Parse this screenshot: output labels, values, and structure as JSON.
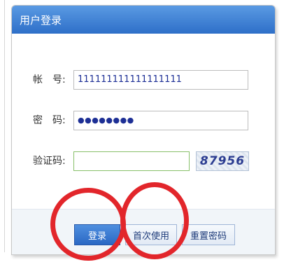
{
  "dialog": {
    "title": "用户登录"
  },
  "form": {
    "account_label": "帐　号:",
    "account_value": "111111111111111111",
    "password_label": "密　码:",
    "password_mask": "●●●●●●●●",
    "captcha_label": "验证码:",
    "captcha_value": "",
    "captcha_image_text": "87956"
  },
  "buttons": {
    "login": "登录",
    "first_use": "首次使用",
    "reset_password": "重置密码"
  },
  "annotations": {
    "color": "#e2262b",
    "circled": [
      "login",
      "first_use"
    ]
  }
}
